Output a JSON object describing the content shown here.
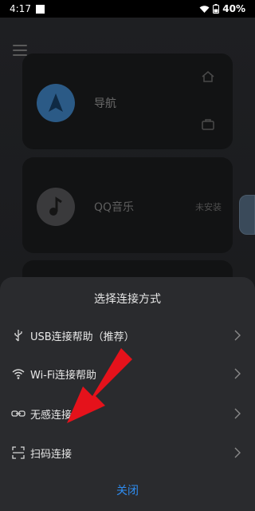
{
  "status_bar": {
    "time": "4:17",
    "battery": "40%"
  },
  "cards": {
    "nav_title": "导航",
    "music_title": "QQ音乐",
    "music_status": "未安装"
  },
  "sheet": {
    "title": "选择连接方式",
    "options": [
      {
        "label": "USB连接帮助（推荐）",
        "icon": "usb-icon"
      },
      {
        "label": "Wi-Fi连接帮助",
        "icon": "wifi-icon"
      },
      {
        "label": "无感连接",
        "icon": "link-icon"
      },
      {
        "label": "扫码连接",
        "icon": "scan-icon"
      }
    ],
    "close_label": "关闭"
  },
  "colors": {
    "accent": "#2f8cf0",
    "annotation_arrow": "#e5121b",
    "sheet_bg": "#2a2b2e"
  }
}
